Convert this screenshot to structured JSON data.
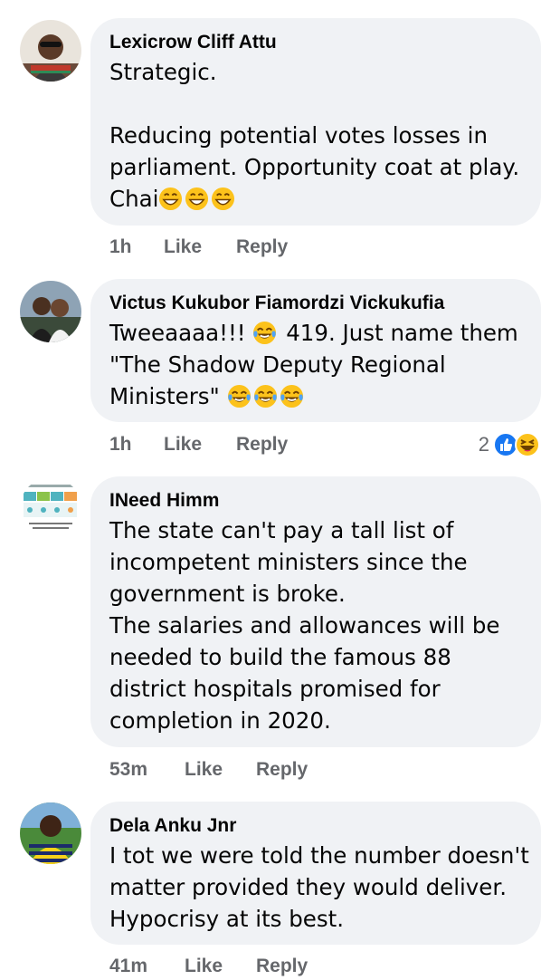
{
  "comments": [
    {
      "author": "Lexicrow Cliff Attu",
      "avatar": "person-avatar",
      "lines": [
        "Strategic.",
        "",
        "Reducing potential votes losses in",
        "parliament. Opportunity coat at play.",
        "Chai"
      ],
      "trailing_emojis": [
        "grinning-face-emoji",
        "grinning-face-emoji",
        "grinning-face-emoji"
      ],
      "time": "1h",
      "like_label": "Like",
      "reply_label": "Reply"
    },
    {
      "author": "Victus Kukubor Fiamordzi Vickukufia",
      "avatar": "person-avatar",
      "line1_before": "Tweeaaaa!!! ",
      "line1_after": " 419. Just name them",
      "line2": "\"The Shadow Deputy Regional",
      "line3": "Ministers\" ",
      "inline_emoji": "tears-of-joy-emoji",
      "trailing_emojis": [
        "tears-of-joy-emoji",
        "tears-of-joy-emoji",
        "tears-of-joy-emoji"
      ],
      "time": "1h",
      "like_label": "Like",
      "reply_label": "Reply",
      "reaction_count": "2",
      "reactions": [
        "like-reaction-icon",
        "haha-reaction-icon"
      ]
    },
    {
      "author": "INeed Himm",
      "avatar": "infographic-avatar",
      "lines": [
        "The state can't pay a tall list of",
        "incompetent ministers since the",
        "government is broke.",
        "The salaries and allowances will be",
        "needed to build the famous 88",
        "district hospitals promised for",
        "completion in 2020."
      ],
      "time": "53m",
      "like_label": "Like",
      "reply_label": "Reply"
    },
    {
      "author": "Dela Anku Jnr",
      "avatar": "person-avatar",
      "lines": [
        "I tot we were told the number doesn't",
        "matter provided they would deliver.",
        "Hypocrisy at its best."
      ],
      "time": "41m",
      "like_label": "Like",
      "reply_label": "Reply"
    }
  ],
  "colors": {
    "bubble": "#f0f2f5",
    "meta_text": "#65676b",
    "like_blue": "#1877f2",
    "emoji_yellow": "#fcc21b"
  }
}
